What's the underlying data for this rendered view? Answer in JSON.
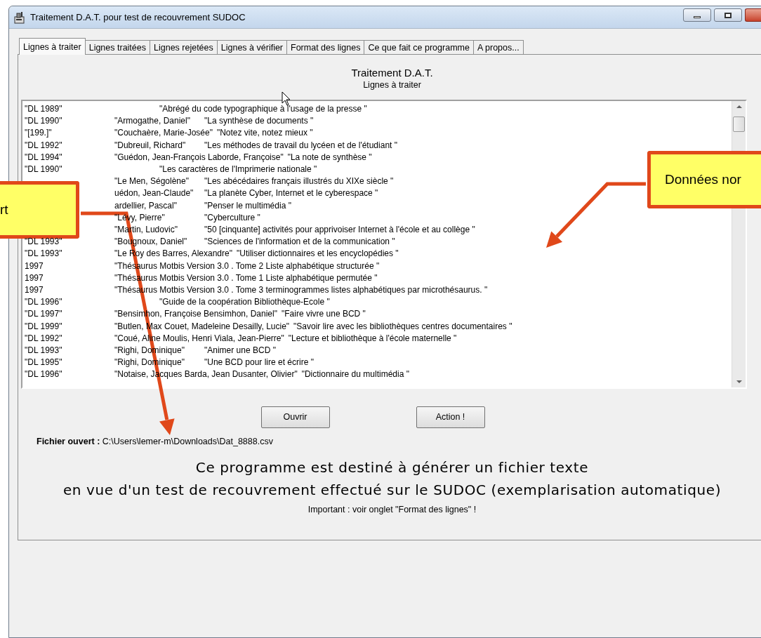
{
  "window": {
    "title": "Traitement D.A.T. pour test de recouvrement SUDOC"
  },
  "tabs": [
    {
      "label": "Lignes à traiter",
      "selected": true
    },
    {
      "label": "Lignes traitées",
      "selected": false
    },
    {
      "label": "Lignes rejetées",
      "selected": false
    },
    {
      "label": "Lignes à vérifier",
      "selected": false
    },
    {
      "label": "Format des lignes",
      "selected": false
    },
    {
      "label": "Ce que fait ce programme",
      "selected": false
    },
    {
      "label": "A propos...",
      "selected": false
    }
  ],
  "panel": {
    "title": "Traitement D.A.T.",
    "subtitle": "Lignes à traiter"
  },
  "list": {
    "rows": [
      {
        "date": "\"DL 1989\"",
        "title": "\"Abrégé du code typographique à l'usage de la presse \""
      },
      {
        "date": "\"DL 1990\"",
        "author": "\"Armogathe, Daniel\"",
        "title": "\"La synthèse de documents \""
      },
      {
        "date": "\"[199.]\"",
        "author": "\"Couchaère, Marie-Josée\"",
        "title": "\"Notez vite, notez mieux \""
      },
      {
        "date": "\"DL 1992\"",
        "author": "\"Dubreuil, Richard\"",
        "title": "\"Les méthodes de travail du lycéen et de l'étudiant \""
      },
      {
        "date": "\"DL 1994\"",
        "author": "\"Guédon, Jean-François Laborde, Françoise\"",
        "title": "\"La note de synthèse \""
      },
      {
        "date": "\"DL 1990\"",
        "title": "\"Les caractères de l'Imprimerie nationale \""
      },
      {
        "author": "\"Le Men, Ségolène\"",
        "title": "\"Les abécédaires français illustrés du XIXe siècle \""
      },
      {
        "author": "uédon, Jean-Claude\"",
        "title": "\"La planète Cyber, Internet et le cyberespace \""
      },
      {
        "author": "ardellier, Pascal\"",
        "title": "\"Penser le multimédia \""
      },
      {
        "author": "\"Lévy, Pierre\"",
        "title": "\"Cyberculture \""
      },
      {
        "author": "\"Martin, Ludovic\"",
        "title": "\"50 [cinquante] activités pour apprivoiser Internet à l'école et au collège \""
      },
      {
        "date": "\"DL 1993\"",
        "author": "\"Bougnoux, Daniel\"",
        "title": "\"Sciences de l'information et de la communication \""
      },
      {
        "date": "\"DL 1993\"",
        "author": "\"Le Roy des Barres, Alexandre\"",
        "title": "\"Utiliser dictionnaires et les encyclopédies \""
      },
      {
        "kind": "date_title",
        "date": "1997",
        "title": "\"Thésaurus Motbis Version 3.0 . Tome 2 Liste alphabétique structurée \""
      },
      {
        "kind": "date_title",
        "date": "1997",
        "title": "\"Thésaurus Motbis Version 3.0 . Tome 1 Liste alphabétique permutée \""
      },
      {
        "kind": "date_title",
        "date": "1997",
        "title": "\"Thésaurus Motbis Version 3.0 . Tome 3 terminogrammes listes alphabétiques par microthésaurus. \""
      },
      {
        "date": "\"DL 1996\"",
        "title": "\"Guide de la coopération Bibliothèque-Ecole \""
      },
      {
        "date": "\"DL 1997\"",
        "author": "\"Bensimhon, Françoise Bensimhon, Daniel\"",
        "title": "\"Faire vivre une BCD \""
      },
      {
        "date": "\"DL 1999\"",
        "author": "\"Butlen, Max Couet, Madeleine Desailly, Lucie\"",
        "title": "\"Savoir lire avec les bibliothèques centres documentaires \""
      },
      {
        "date": "\"DL 1992\"",
        "author": "\"Coué, Aline Moulis, Henri Viala, Jean-Pierre\"",
        "title": "\"Lecture et bibliothèque à l'école maternelle \""
      },
      {
        "date": "\"DL 1993\"",
        "author": "\"Righi, Dominique\"",
        "title": "\"Animer une BCD \""
      },
      {
        "date": "\"DL 1995\"",
        "author": "\"Righi, Dominique\"",
        "title": "\"Une BCD pour lire et écrire \""
      },
      {
        "date": "\"DL 1996\"",
        "author": "\"Notaise, Jacques Barda, Jean Dusanter, Olivier\"",
        "title": "\"Dictionnaire du multimédia \""
      }
    ]
  },
  "buttons": [
    "Ouvrir",
    "Action !"
  ],
  "open_file": "**Fichier ouvert :** C:\\Users\\lemer-m\\Downloads\\Dat_8888.csv",
  "description": [
    "Ce programme est destiné à générer un fichier texte",
    "en vue d'un test de recouvrement effectué sur le SUDOC (exemplarisation automatique)"
  ],
  "note": "Important : voir onglet \"Format des lignes\" !",
  "callouts": [
    {
      "text": "rt"
    },
    {
      "text": "Données nor"
    }
  ]
}
